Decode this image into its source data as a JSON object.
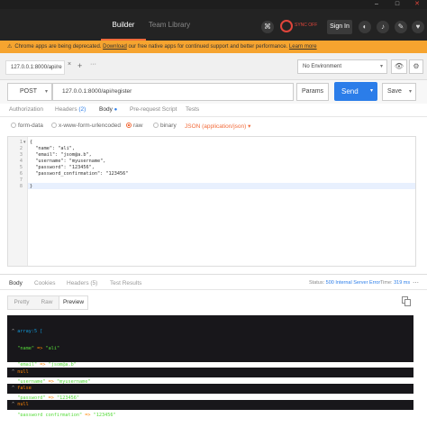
{
  "window": {
    "controls": [
      "–",
      "□",
      "✕"
    ]
  },
  "topbar": {
    "tabs": [
      {
        "label": "Builder",
        "active": true
      },
      {
        "label": "Team Library",
        "active": false
      }
    ],
    "sync_label": "SYNC OFF",
    "signin_label": "Sign In"
  },
  "warning": {
    "text": "Chrome apps are being deprecated. ",
    "link1": "Download",
    "text2": " our free native apps for continued support and better performance. ",
    "link2": "Learn more"
  },
  "request_tab": {
    "label": "127.0.0.1:8000/api/re",
    "close": "×",
    "add": "+",
    "more": "···"
  },
  "environment": {
    "selected": "No Environment"
  },
  "request": {
    "method": "POST",
    "url": "127.0.0.1:8000/api/register",
    "params_label": "Params",
    "send_label": "Send",
    "save_label": "Save"
  },
  "request_tabs": [
    {
      "label": "Authorization",
      "active": false
    },
    {
      "label": "Headers",
      "count": "(2)",
      "active": false
    },
    {
      "label": "Body",
      "active": true
    },
    {
      "label": "Pre-request Script",
      "active": false
    },
    {
      "label": "Tests",
      "active": false
    }
  ],
  "body_types": [
    {
      "label": "form-data",
      "checked": false
    },
    {
      "label": "x-www-form-urlencoded",
      "checked": false
    },
    {
      "label": "raw",
      "checked": true
    },
    {
      "label": "binary",
      "checked": false
    }
  ],
  "content_type": "JSON (application/json)",
  "editor": {
    "line_numbers": [
      "1",
      "2",
      "3",
      "4",
      "5",
      "6",
      "7",
      "8"
    ],
    "lines": [
      "{",
      "  \"name\": \"ali\",",
      "  \"email\": \"jsom@a.b\",",
      "  \"username\": \"myusername\",",
      "  \"password\": \"123456\",",
      "  \"password_confirmation\": \"123456\"",
      "",
      "}"
    ]
  },
  "response_tabs": [
    {
      "label": "Body",
      "active": true
    },
    {
      "label": "Cookies",
      "active": false
    },
    {
      "label": "Headers",
      "count": "(5)",
      "active": false
    },
    {
      "label": "Test Results",
      "active": false
    }
  ],
  "status": {
    "label": "Status:",
    "value": "500 Internal Server Error"
  },
  "time": {
    "label": "Time:",
    "value": "319 ms"
  },
  "view_modes": [
    {
      "label": "Pretty",
      "active": false
    },
    {
      "label": "Raw",
      "active": false
    },
    {
      "label": "Preview",
      "active": true
    }
  ],
  "dump_array": {
    "header": "array:5 [",
    "entries": [
      {
        "key": "\"name\"",
        "value": "\"ali\""
      },
      {
        "key": "\"email\"",
        "value": "\"jsom@a.b\""
      },
      {
        "key": "\"username\"",
        "value": "\"myusername\""
      },
      {
        "key": "\"password\"",
        "value": "\"123456\""
      },
      {
        "key": "\"password_confirmation\"",
        "value": "\"123456\""
      }
    ],
    "footer": "]",
    "arrow": "=>"
  },
  "dumps": [
    "null",
    "false",
    "null"
  ],
  "colors": {
    "accent": "#f26b3a",
    "send_blue": "#2b7de9",
    "warning_bg": "#f6a42f",
    "dump_bg": "#18171b"
  }
}
